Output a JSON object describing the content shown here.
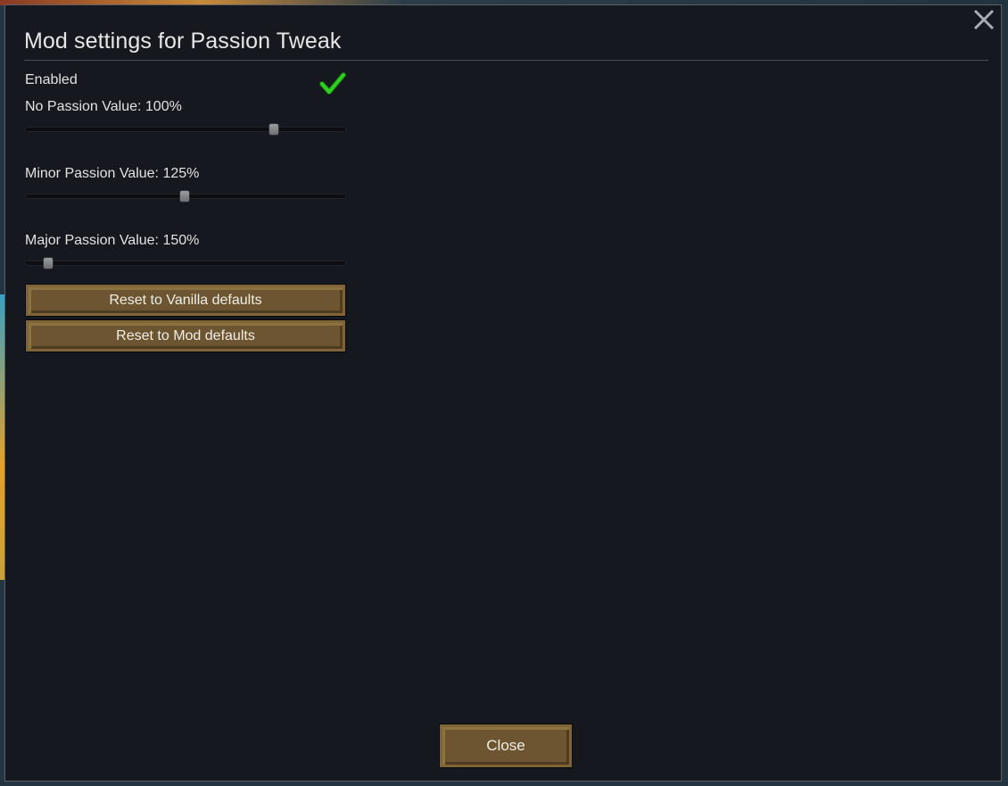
{
  "dialog": {
    "title": "Mod settings for Passion Tweak",
    "close_icon": "close-x-icon"
  },
  "settings": {
    "enabled": {
      "label": "Enabled",
      "checked": true,
      "icon": "checkmark-icon",
      "check_color": "#2fd11f"
    },
    "sliders": [
      {
        "label": "No Passion Value: 100%",
        "value_fraction": 0.775
      },
      {
        "label": "Minor Passion Value: 125%",
        "value_fraction": 0.497
      },
      {
        "label": "Major Passion Value: 150%",
        "value_fraction": 0.072
      }
    ]
  },
  "buttons": {
    "reset_vanilla": "Reset to Vanilla defaults",
    "reset_mod": "Reset to Mod defaults",
    "close": "Close"
  },
  "colors": {
    "window_bg": "#15191f",
    "button_bg": "#6c5530",
    "text": "#e2e2e2"
  }
}
